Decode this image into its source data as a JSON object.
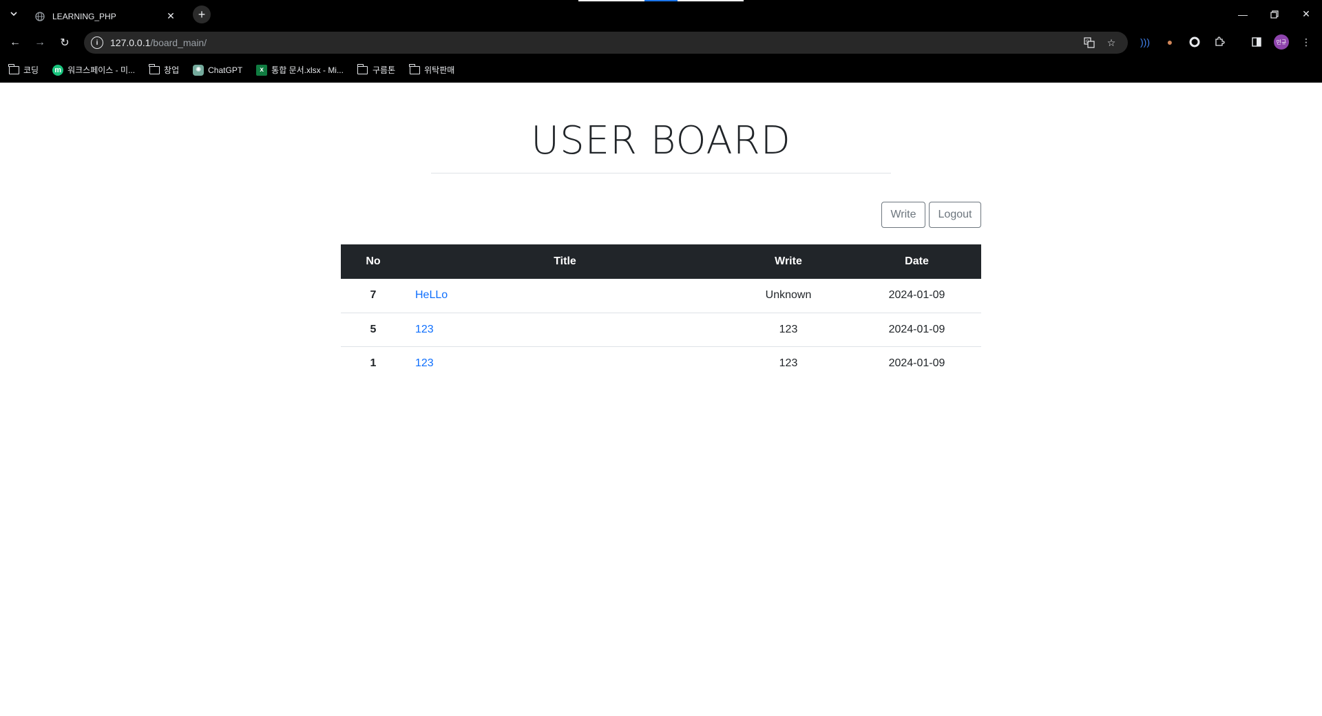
{
  "browser": {
    "tab_title": "LEARNING_PHP",
    "url_host": "127.0.0.1",
    "url_path": "/board_main/",
    "profile_initial": "민규"
  },
  "bookmarks": [
    {
      "label": "코딩",
      "icon": "folder-icon"
    },
    {
      "label": "워크스페이스 - 미...",
      "icon": "m-icon"
    },
    {
      "label": "창업",
      "icon": "folder-icon"
    },
    {
      "label": "ChatGPT",
      "icon": "chatgpt-icon"
    },
    {
      "label": "통합 문서.xlsx - Mi...",
      "icon": "excel-icon"
    },
    {
      "label": "구름톤",
      "icon": "folder-icon"
    },
    {
      "label": "위탁판매",
      "icon": "folder-icon"
    }
  ],
  "page": {
    "title": "USER BOARD",
    "write_button": "Write",
    "logout_button": "Logout"
  },
  "table": {
    "headers": {
      "no": "No",
      "title": "Title",
      "write": "Write",
      "date": "Date"
    },
    "rows": [
      {
        "no": "7",
        "title": "HeLLo",
        "write": "Unknown",
        "date": "2024-01-09"
      },
      {
        "no": "5",
        "title": "123",
        "write": "123",
        "date": "2024-01-09"
      },
      {
        "no": "1",
        "title": "123",
        "write": "123",
        "date": "2024-01-09"
      }
    ]
  },
  "colors": {
    "browser_bg": "#000000",
    "table_header_bg": "#212529",
    "link": "#0d6efd",
    "button_border": "#6c757d"
  }
}
